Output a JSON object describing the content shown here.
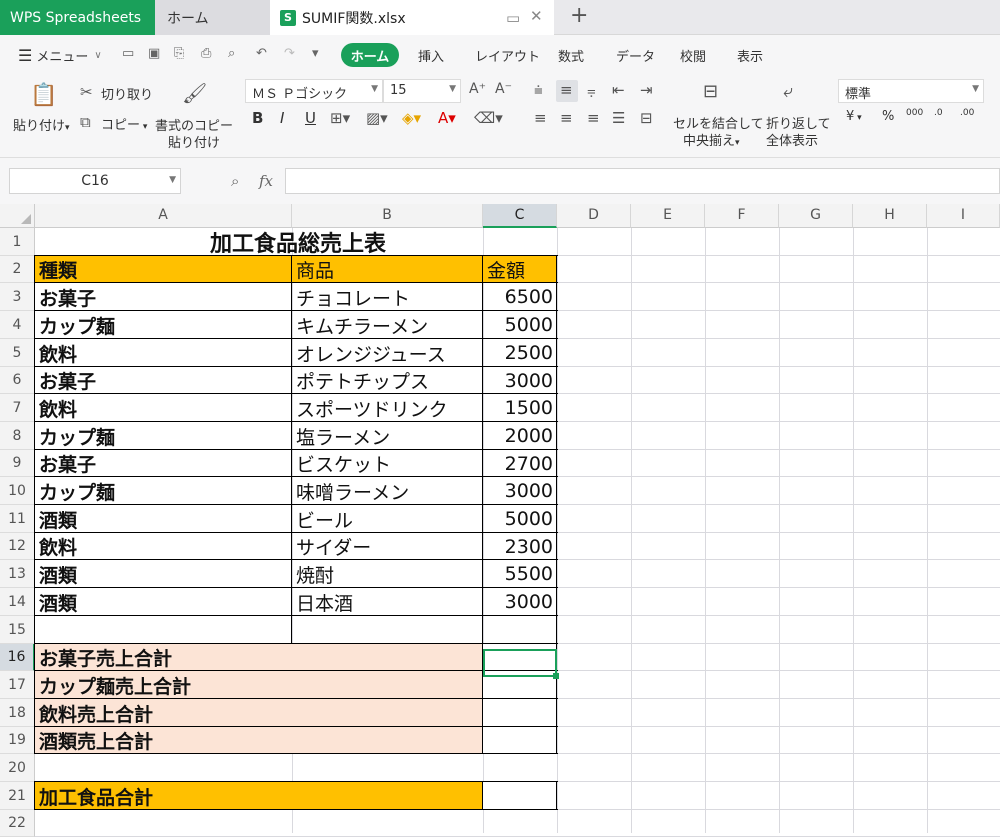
{
  "tabs": {
    "app": "WPS Spreadsheets",
    "home": "ホーム",
    "file": "SUMIF関数.xlsx",
    "file_icon": "S"
  },
  "menu": {
    "main": "メニュー",
    "items": [
      "ホーム",
      "挿入",
      "レイアウト",
      "数式",
      "データ",
      "校閲",
      "表示"
    ]
  },
  "ribbon": {
    "paste": "貼り付け",
    "cut": "切り取り",
    "copy": "コピー",
    "format_copy_1": "書式のコピー",
    "format_copy_2": "貼り付け",
    "font": "ＭＳ Ｐゴシック",
    "font_size": "15",
    "bold": "B",
    "italic": "I",
    "underline": "U",
    "merge_1": "セルを結合して",
    "merge_2": "中央揃え",
    "wrap_1": "折り返して",
    "wrap_2": "全体表示",
    "number_format": "標準",
    "yen": "¥",
    "percent": "%",
    "thousands": "000",
    "dec_inc": ".0",
    "dec_dec": ".00"
  },
  "formula_bar": {
    "name_box": "C16",
    "fx": "fx",
    "value": ""
  },
  "columns": [
    "A",
    "B",
    "C",
    "D",
    "E",
    "F",
    "G",
    "H",
    "I"
  ],
  "rows": [
    "1",
    "2",
    "3",
    "4",
    "5",
    "6",
    "7",
    "8",
    "9",
    "10",
    "11",
    "12",
    "13",
    "14",
    "15",
    "16",
    "17",
    "18",
    "19",
    "20",
    "21",
    "22"
  ],
  "sheet": {
    "title": "加工食品総売上表",
    "headers": [
      "種類",
      "商品",
      "金額"
    ],
    "data": [
      [
        "お菓子",
        "チョコレート",
        "6500"
      ],
      [
        "カップ麺",
        "キムチラーメン",
        "5000"
      ],
      [
        "飲料",
        "オレンジジュース",
        "2500"
      ],
      [
        "お菓子",
        "ポテトチップス",
        "3000"
      ],
      [
        "飲料",
        "スポーツドリンク",
        "1500"
      ],
      [
        "カップ麺",
        "塩ラーメン",
        "2000"
      ],
      [
        "お菓子",
        "ビスケット",
        "2700"
      ],
      [
        "カップ麺",
        "味噌ラーメン",
        "3000"
      ],
      [
        "酒類",
        "ビール",
        "5000"
      ],
      [
        "飲料",
        "サイダー",
        "2300"
      ],
      [
        "酒類",
        "焼酎",
        "5500"
      ],
      [
        "酒類",
        "日本酒",
        "3000"
      ]
    ],
    "subtotals": [
      "お菓子売上合計",
      "カップ麺売上合計",
      "飲料売上合計",
      "酒類売上合計"
    ],
    "grand_total": "加工食品合計"
  },
  "colors": {
    "accent": "#1aa05a",
    "header_fill": "#ffc000",
    "subtotal_fill": "#fce4d6"
  }
}
